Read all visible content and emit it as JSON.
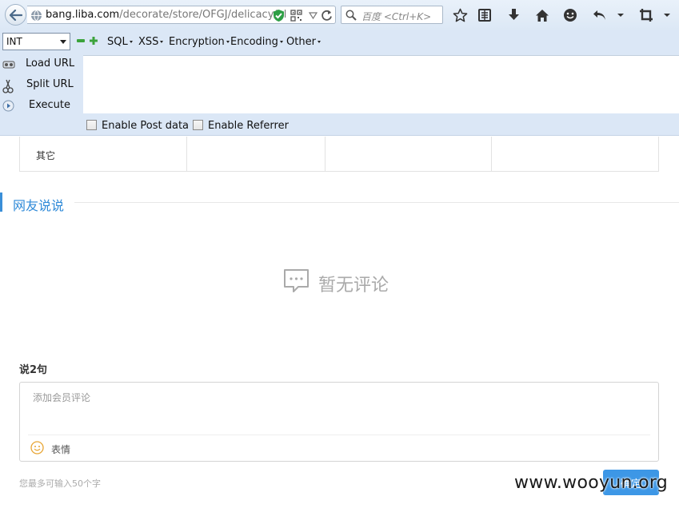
{
  "browser": {
    "url_domain": "bang.liba.com",
    "url_path": "/decorate/store/OFGJ/delicacy/al",
    "search_placeholder": "百度 <Ctrl+K>"
  },
  "hackbar": {
    "select_value": "INT",
    "menus": [
      "SQL",
      "XSS",
      "Encryption",
      "Encoding",
      "Other"
    ],
    "actions": {
      "load_url": "Load URL",
      "split_url": "Split URL",
      "execute": "Execute"
    },
    "checkboxes": {
      "post_data": "Enable Post data",
      "referrer": "Enable Referrer"
    },
    "textarea_value": ""
  },
  "page": {
    "table_label": "其它",
    "section_title": "网友说说",
    "empty_text": "暂无评论",
    "say_label": "说2句",
    "comment_placeholder": "添加会员评论",
    "emoji_label": "表情",
    "limit_text": "您最多可输入50个字",
    "submit_label": "确定",
    "watermark": "www.wooyun.org"
  },
  "colors": {
    "accent": "#2f8ad8",
    "button": "#3d97e6",
    "toolbar_bg": "#dbe7f6"
  },
  "icons": [
    "back-arrow-icon",
    "globe-icon",
    "shield-check-icon",
    "qr-code-icon",
    "dropdown-icon",
    "reload-icon",
    "search-icon",
    "star-icon",
    "reading-list-icon",
    "download-icon",
    "home-icon",
    "smiley-icon",
    "undo-icon",
    "menu-caret-icon",
    "crop-icon",
    "overflow-icon",
    "load-url-icon",
    "split-url-icon",
    "execute-icon",
    "comment-bubble-icon",
    "emoji-icon"
  ]
}
